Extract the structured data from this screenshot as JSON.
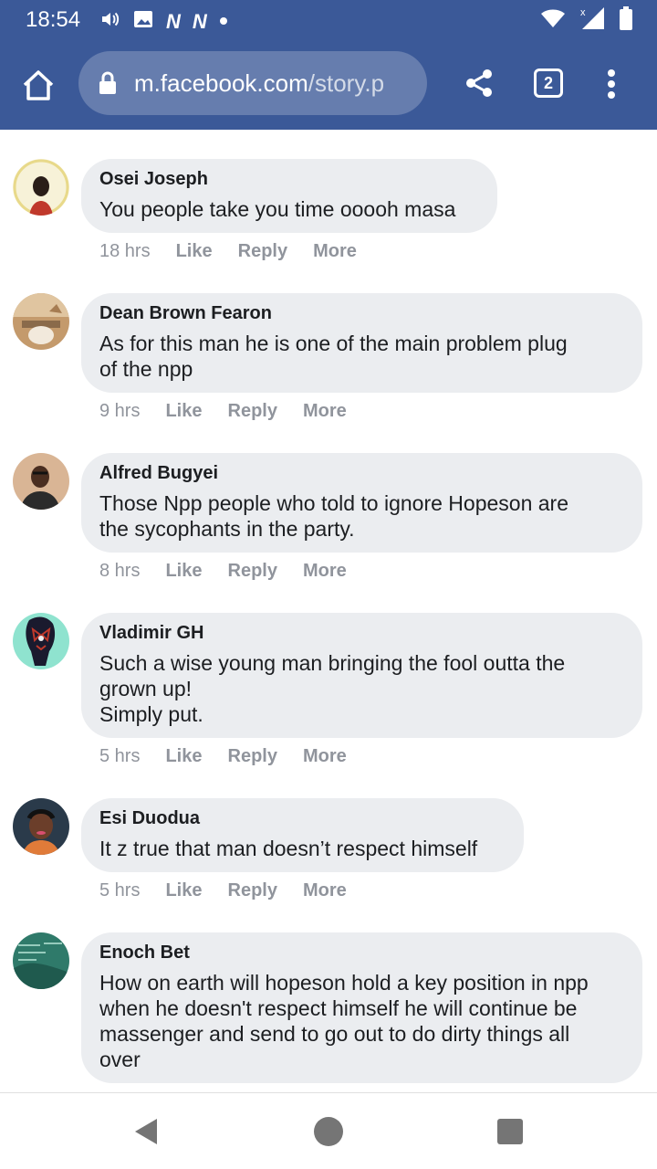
{
  "status_bar": {
    "time": "18:54",
    "icons_left": [
      "volume-icon",
      "image-icon",
      "n-notification-icon",
      "n-notification-icon",
      "dot-icon"
    ],
    "icons_right": [
      "wifi-icon",
      "signal-icon",
      "battery-icon"
    ],
    "n_label": "N"
  },
  "toolbar": {
    "url_domain": "m.facebook.com",
    "url_path": "/story.p",
    "tab_count": "2",
    "color": "#3b5998"
  },
  "comments": [
    {
      "author": "Osei Joseph",
      "text": "You people take you time ooooh masa",
      "time": "18 hrs",
      "avatar_color": "#e8d98a"
    },
    {
      "author": "Dean Brown Fearon",
      "text": "As for this man he is one of the main problem plug\nof the npp",
      "time": "9 hrs",
      "avatar_color": "#b98f6a"
    },
    {
      "author": "Alfred Bugyei",
      "text": "Those Npp people who told to ignore Hopeson are\nthe sycophants in the party.",
      "time": "8 hrs",
      "avatar_color": "#c9a383"
    },
    {
      "author": "Vladimir GH",
      "text": "Such a wise young man bringing the fool outta the\ngrown up!\nSimply put.",
      "time": "5 hrs",
      "avatar_color": "#8fe3cf"
    },
    {
      "author": "Esi Duodua",
      "text": "It z true that man doesn’t respect himself",
      "time": "5 hrs",
      "avatar_color": "#3d2c2a"
    },
    {
      "author": "Enoch Bet",
      "text": "How on earth will hopeson hold a key position in npp\nwhen he doesn't respect himself he will continue be\nmassenger and send to go out to do dirty things all\nover",
      "time": "",
      "avatar_color": "#2f7a6a"
    }
  ],
  "actions": {
    "like": "Like",
    "reply": "Reply",
    "more": "More"
  },
  "nav_bar": {
    "buttons": [
      "back-icon",
      "home-icon",
      "recents-icon"
    ]
  }
}
